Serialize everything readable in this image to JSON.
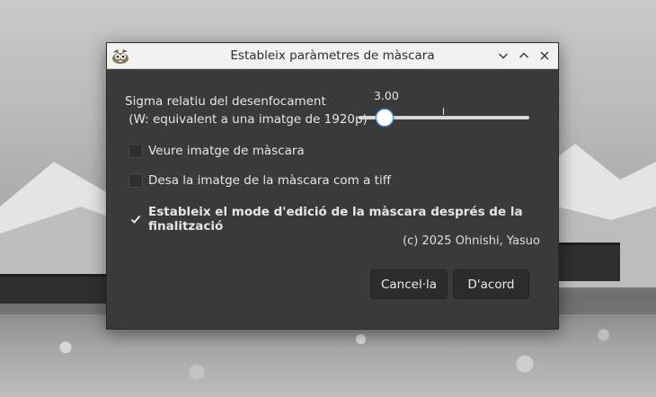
{
  "dialog": {
    "title": "Estableix paràmetres de màscara",
    "window_controls": {
      "minimize_icon": "chevron-down-icon",
      "maximize_icon": "chevron-up-icon",
      "close_icon": "close-icon"
    }
  },
  "sigma": {
    "label_line1": "Sigma relatiu del desenfocament",
    "label_line2": " (W: equivalent a una imatge de 1920p)",
    "value_text": "3.00",
    "value": 3.0,
    "fill_fraction": 0.155
  },
  "options": [
    {
      "label": "Veure imatge de màscara",
      "checked": false
    },
    {
      "label": "Desa la imatge de la màscara com a tiff",
      "checked": false
    },
    {
      "label": "Estableix el mode d'edició de la màscara després de la finalització",
      "checked": true
    }
  ],
  "copyright": "(c) 2025 Ohnishi, Yasuo",
  "buttons": {
    "cancel": "Cancel·la",
    "ok": "D'acord"
  },
  "colors": {
    "dialog_bg": "#3a3a3a",
    "titlebar_bg": "#f2f2f2",
    "slider_accent": "#3b8fd6"
  }
}
